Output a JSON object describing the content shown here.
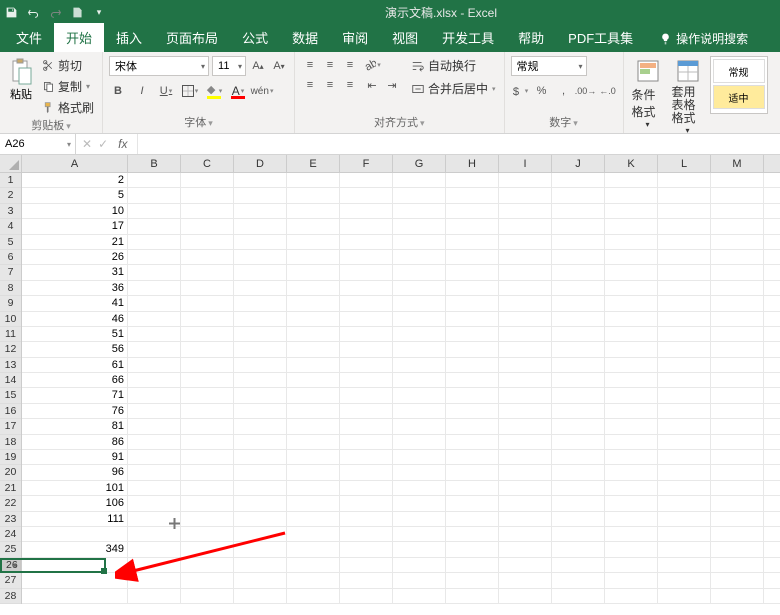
{
  "title": "演示文稿.xlsx - Excel",
  "tabs": [
    "文件",
    "开始",
    "插入",
    "页面布局",
    "公式",
    "数据",
    "审阅",
    "视图",
    "开发工具",
    "帮助",
    "PDF工具集"
  ],
  "active_tab": 1,
  "tell_me": "操作说明搜索",
  "clipboard": {
    "cut": "剪切",
    "copy": "复制",
    "paint": "格式刷",
    "label": "剪贴板"
  },
  "font": {
    "name": "宋体",
    "size": "11",
    "label": "字体"
  },
  "alignment": {
    "wrap": "自动换行",
    "merge": "合并后居中",
    "label": "对齐方式"
  },
  "number": {
    "format": "常规",
    "label": "数字"
  },
  "styles": {
    "cond": "条件格式",
    "table": "套用\n表格格式",
    "normal": "常规",
    "good": "适中"
  },
  "namebox": "A26",
  "col_letters": [
    "A",
    "B",
    "C",
    "D",
    "E",
    "F",
    "G",
    "H",
    "I",
    "J",
    "K",
    "L",
    "M"
  ],
  "rows": [
    "1",
    "2",
    "3",
    "4",
    "5",
    "6",
    "7",
    "8",
    "9",
    "10",
    "11",
    "12",
    "13",
    "14",
    "15",
    "16",
    "17",
    "18",
    "19",
    "20",
    "21",
    "22",
    "23",
    "24",
    "25",
    "26",
    "27",
    "28"
  ],
  "data_A": [
    "2",
    "5",
    "10",
    "17",
    "21",
    "26",
    "31",
    "36",
    "41",
    "46",
    "51",
    "56",
    "61",
    "66",
    "71",
    "76",
    "81",
    "86",
    "91",
    "96",
    "101",
    "106",
    "111",
    "",
    "349",
    "",
    "",
    ""
  ],
  "selected_row_index": 25
}
